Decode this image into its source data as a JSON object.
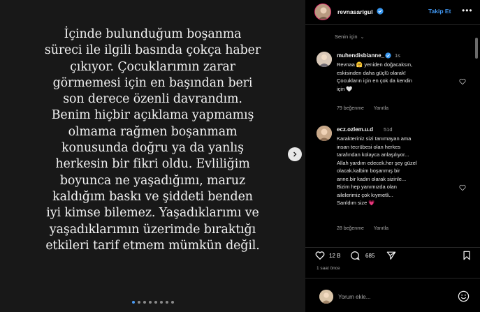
{
  "post": {
    "lines": [
      "İçinde bulunduğum boşanma",
      "süreci ile ilgili basında çokça haber",
      "çıkıyor. Çocuklarımın zarar",
      "görmemesi için en başından beri",
      "son derece özenli davrandım.",
      "Benim hiçbir açıklama yapmamış",
      "olmama rağmen boşanmam",
      "konusunda doğru ya da yanlış",
      "herkesin bir fikri oldu. Evliliğim",
      "boyunca ne yaşadığımı, maruz",
      "kaldığım baskı ve şiddeti benden",
      "iyi kimse bilemez. Yaşadıklarımı ve",
      "yaşadıklarımın üzerimde bıraktığı",
      "etkileri tarif etmem mümkün değil."
    ],
    "dots_total": 8,
    "dot_active_index": 0,
    "next_icon": "chevron-right-icon"
  },
  "header": {
    "username": "revnasarigul",
    "follow_label": "Takip Et",
    "more_label": "•••"
  },
  "for_you": {
    "label": "Senin için",
    "icon": "chevron-down-icon"
  },
  "comments": [
    {
      "username": "muhendisbianne_",
      "time": "1s",
      "lines": [
        "Revnaa 🤗 yeniden doğacaksın,",
        "eskisinden daha güçlü olarak!",
        "Çocukların için en çok da kendin",
        "için 🤍"
      ],
      "likes": "79 beğenme",
      "reply": "Yanıtla"
    },
    {
      "username": "ecz.ozlem.u.d",
      "time": "51d",
      "lines": [
        "Karakteriniz sizi tanımayan ama",
        "insan tecrübesi olan herkes",
        "tarafından kolayca anlaşılıyor...",
        "Allah yardım edecek.her şey güzel",
        "olacak.kalbim boşanmış bir",
        "anne.bir kadın olarak sizinle...",
        "Bizim hep yanımızda olan",
        "ailelerimiz çok kıymetli...",
        "Sarıldım size 💗"
      ],
      "likes": "28 beğenme",
      "reply": "Yanıtla"
    }
  ],
  "actions": {
    "likes_count": "12 B",
    "comments_count": "685",
    "time_ago": "1 saat önce"
  },
  "comment_box": {
    "placeholder": "Yorum ekle...",
    "emoji_icon": "smile-icon"
  },
  "colors": {
    "accent": "#4096f0",
    "verified": "#3897f0",
    "background": "#000000",
    "media_bg": "#181818"
  }
}
